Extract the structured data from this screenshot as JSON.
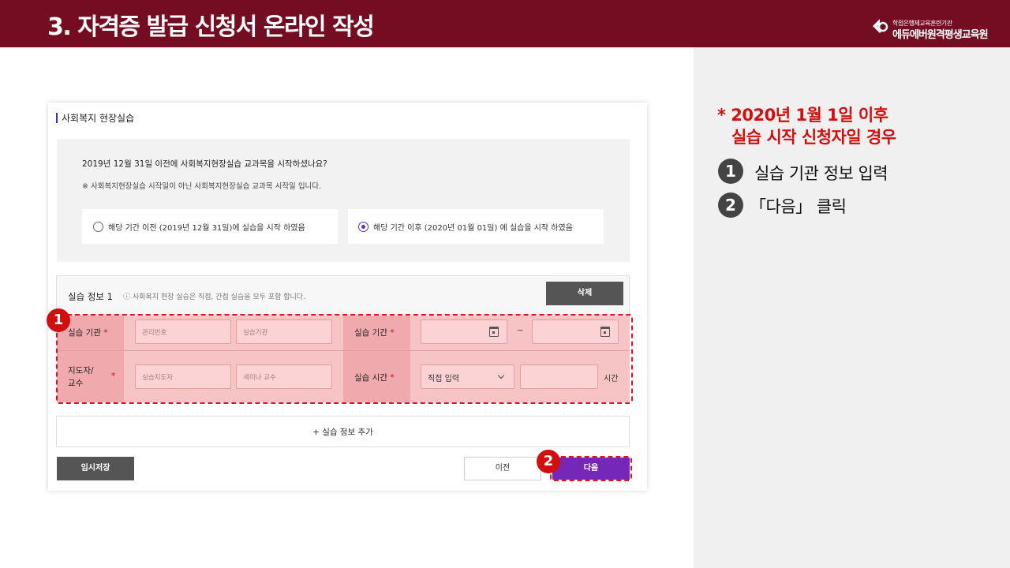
{
  "header": {
    "title": "3. 자격증 발급 신청서 온라인 작성",
    "logo_sub": "학점은행제교육훈련기관",
    "logo_name": "에듀에버원격평생교육원"
  },
  "guide": {
    "note_line1": "* 2020년 1월 1일 이후",
    "note_line2": "실습 시작 신청자일 경우",
    "steps": [
      {
        "badge": "1",
        "text": "실습 기관 정보 입력"
      },
      {
        "badge": "2",
        "text": "「다음」 클릭"
      }
    ]
  },
  "form": {
    "section_title": "사회복지 현장실습",
    "question": "2019년 12월 31일 이전에 사회복지현장실습 교과목을 시작하셨나요?",
    "question_note": "※ 사회복지현장실습 시작일이 아닌 사회복지현장실습 교과목 시작일 입니다.",
    "options": [
      {
        "label": "해당 기간 이전 (2019년 12월 31일)에 실습을 시작 하였음",
        "selected": false
      },
      {
        "label": "해당 기간 이후 (2020년 01월 01일) 에 실습을 시작 하였음",
        "selected": true
      }
    ],
    "info": {
      "title": "실습 정보 1",
      "hint": "ⓘ 사회복지 현장 실습은 직접, 간접 실습을 모두 포함 합니다.",
      "delete_label": "삭제"
    },
    "rows": {
      "org_label": "실습 기관",
      "org_code_placeholder": "관리번호",
      "org_name_placeholder": "실습기관",
      "period_label": "실습 기간",
      "period_sep": "~",
      "supervisor_label": "지도자/교수",
      "supervisor_placeholder": "실습지도자",
      "professor_placeholder": "세미나 교수",
      "hours_label": "실습 시간",
      "hours_select": "직접 입력",
      "hours_unit": "시간"
    },
    "required_mark": "*",
    "add_label": "+ 실습 정보 추가",
    "buttons": {
      "temp_save": "임시저장",
      "prev": "이전",
      "next": "다음"
    },
    "callouts": {
      "one": "1",
      "two": "2"
    }
  },
  "colors": {
    "header_bg": "#750d22",
    "accent_purple": "#7527b8",
    "highlight_red": "#e0151b",
    "note_red": "#d40d0d"
  }
}
